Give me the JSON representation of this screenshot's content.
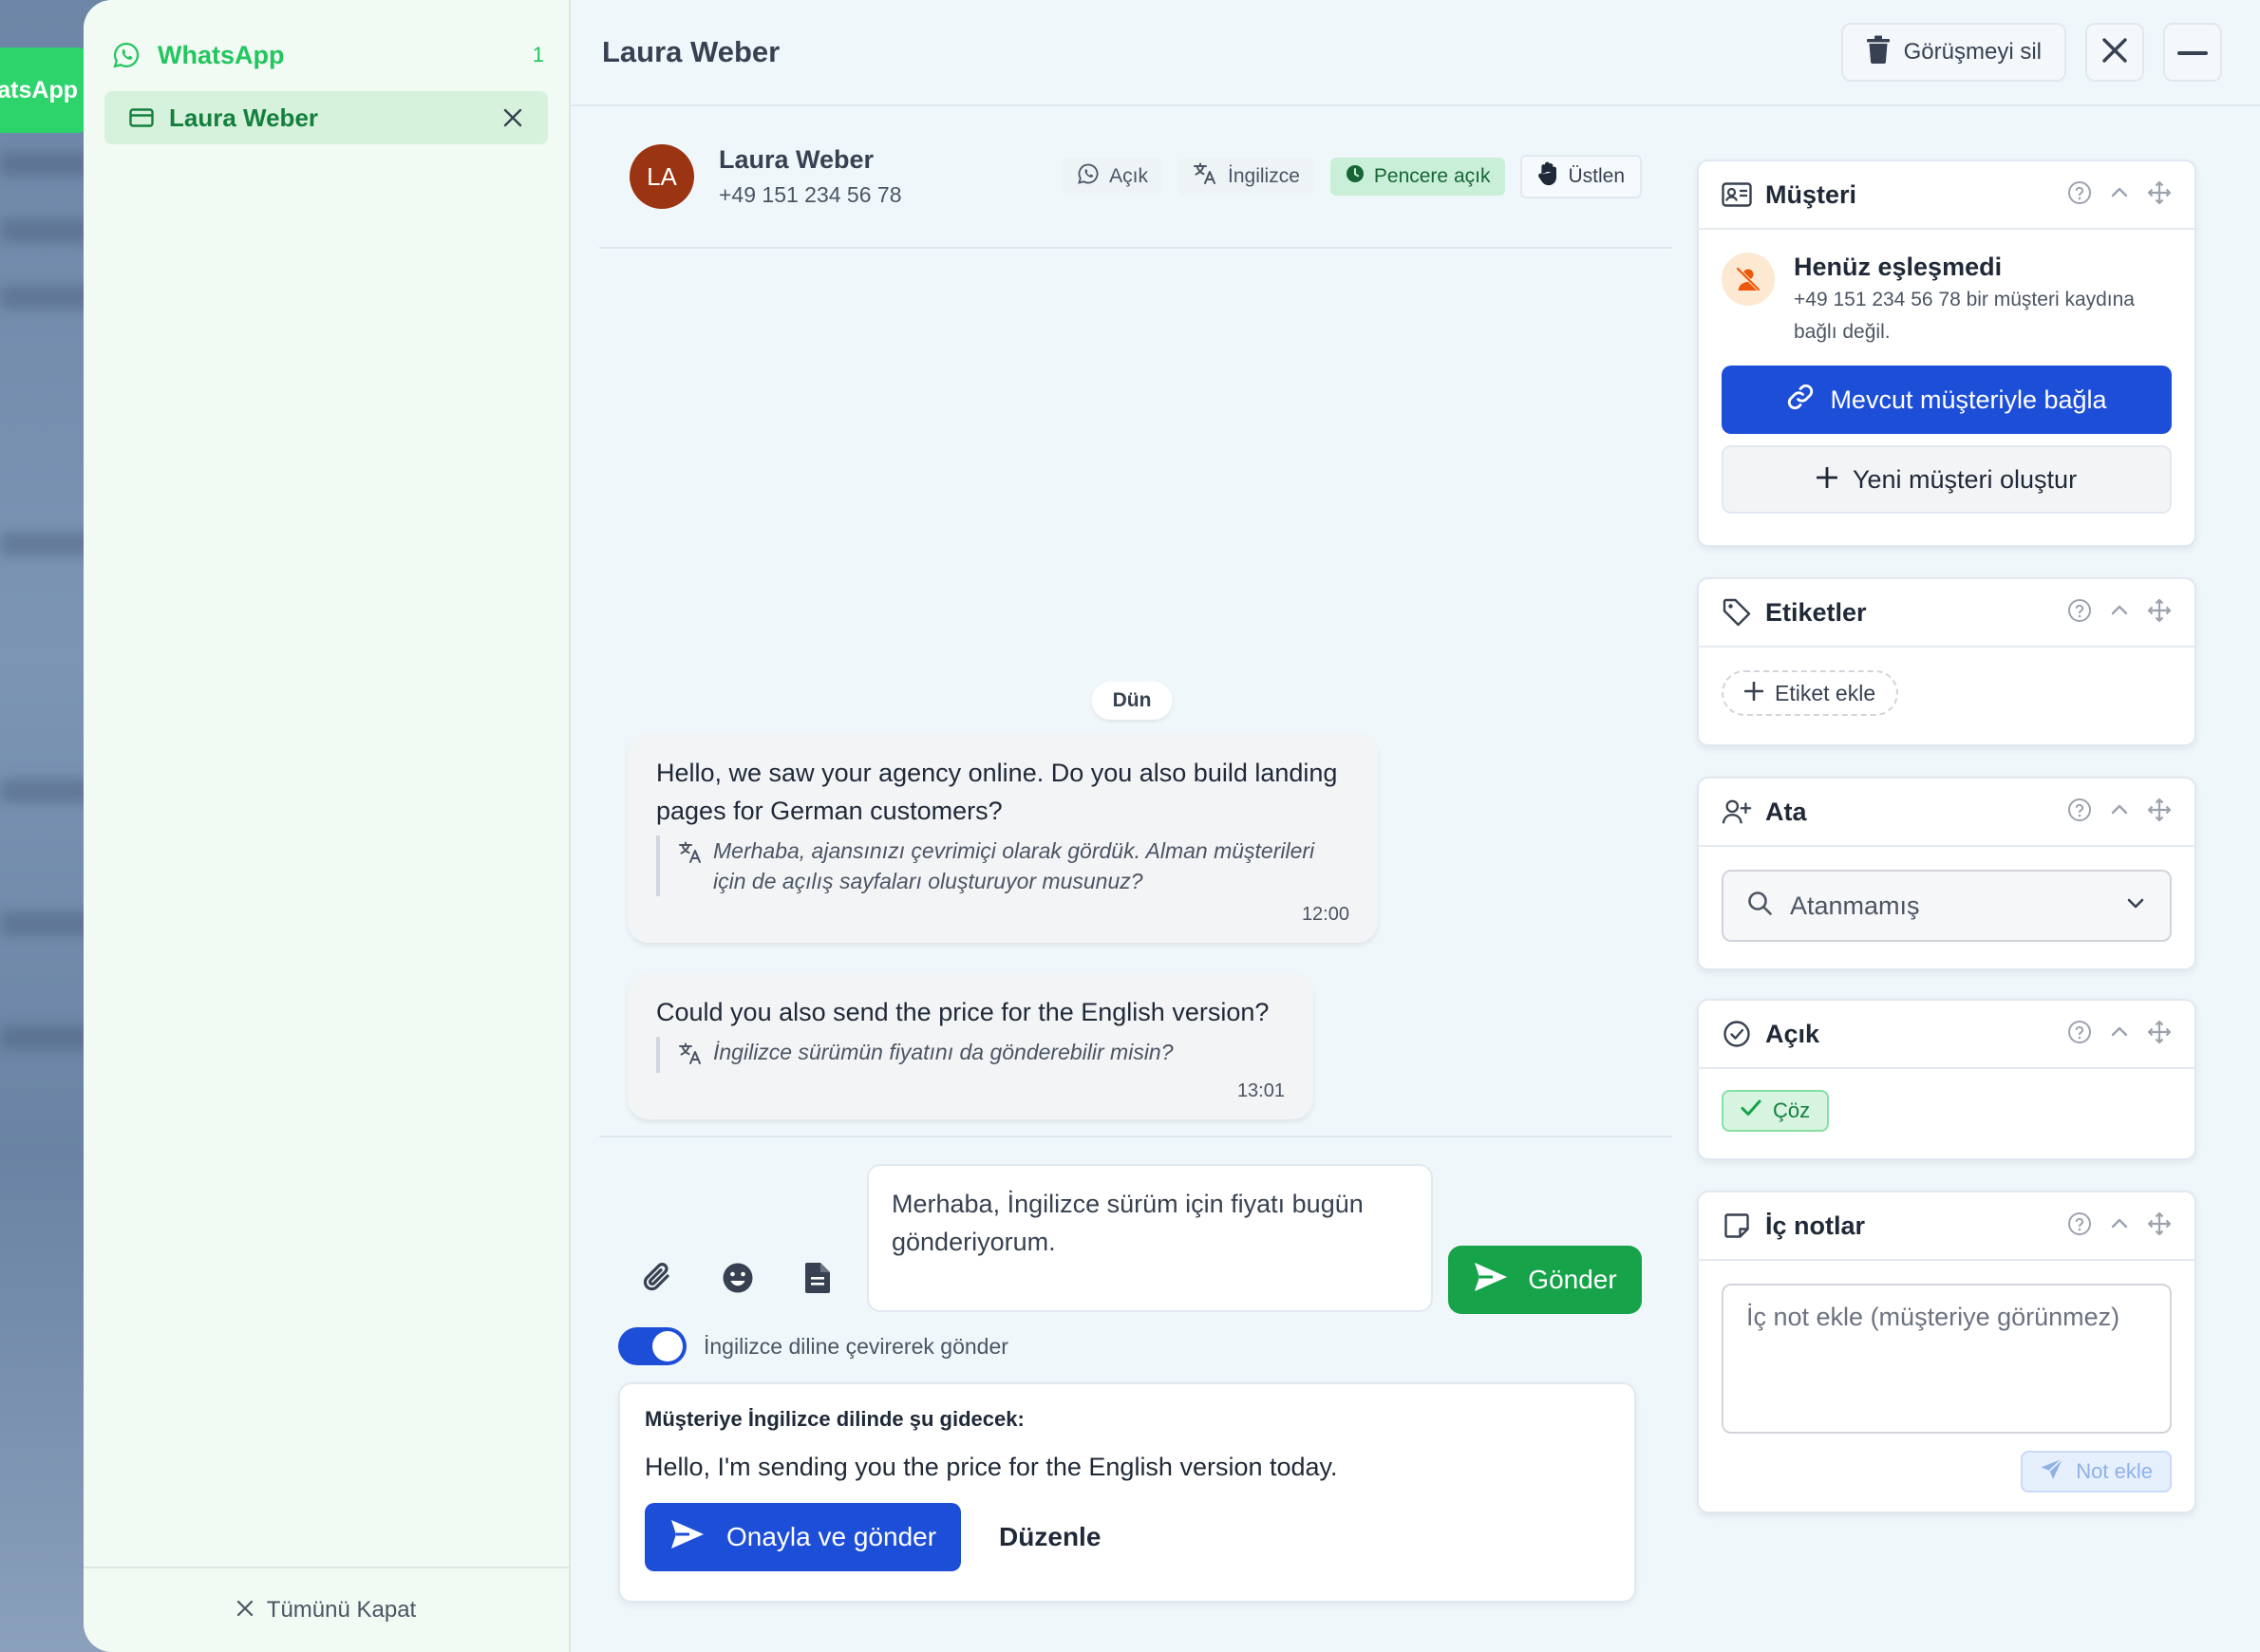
{
  "background": {
    "tab_label": "atsApp"
  },
  "sidebar": {
    "channel": {
      "label": "WhatsApp",
      "count": "1"
    },
    "items": [
      {
        "label": "Laura Weber"
      }
    ],
    "footer_label": "Tümünü Kapat"
  },
  "topbar": {
    "title": "Laura Weber",
    "delete_label": "Görüşmeyi sil"
  },
  "contact": {
    "initials": "LA",
    "name": "Laura Weber",
    "phone": "+49 151 234 56 78",
    "chips": {
      "status": "Açık",
      "language": "İngilizce",
      "window": "Pencere açık",
      "takeover": "Üstlen"
    }
  },
  "chat": {
    "day_label": "Dün",
    "messages": [
      {
        "original": "Hello, we saw your agency online. Do you also build landing pages for German customers?",
        "translation": "Merhaba, ajansınızı çevrimiçi olarak gördük. Alman müşterileri için de açılış sayfaları oluşturuyor musunuz?",
        "time": "12:00"
      },
      {
        "original": "Could you also send the price for the English version?",
        "translation": "İngilizce sürümün fiyatını da gönderebilir misin?",
        "time": "13:01"
      }
    ]
  },
  "composer": {
    "draft": "Merhaba, İngilizce sürüm için fiyatı bugün gönderiyorum.",
    "send_label": "Gönder",
    "translate_toggle_label": "İngilizce diline çevirerek gönder",
    "translate_enabled": true,
    "preview_title": "Müşteriye İngilizce dilinde şu gidecek:",
    "preview_text": "Hello, I'm sending you the price for the English version today.",
    "approve_label": "Onayla ve gönder",
    "edit_label": "Düzenle"
  },
  "panels": {
    "customer": {
      "title": "Müşteri",
      "unmatched_title": "Henüz eşleşmedi",
      "unmatched_desc": "+49 151 234 56 78 bir müşteri kaydına bağlı değil.",
      "link_label": "Mevcut müşteriyle bağla",
      "create_label": "Yeni müşteri oluştur"
    },
    "tags": {
      "title": "Etiketler",
      "add_label": "Etiket ekle"
    },
    "assign": {
      "title": "Ata",
      "value": "Atanmamış"
    },
    "status": {
      "title": "Açık",
      "resolve_label": "Çöz"
    },
    "notes": {
      "title": "İç notlar",
      "placeholder": "İç not ekle (müşteriye görünmez)",
      "add_label": "Not ekle"
    }
  },
  "colors": {
    "whatsapp_green": "#22c55e",
    "primary_blue": "#1d4ed8",
    "send_green": "#16a34a",
    "avatar": "#9a3412"
  }
}
